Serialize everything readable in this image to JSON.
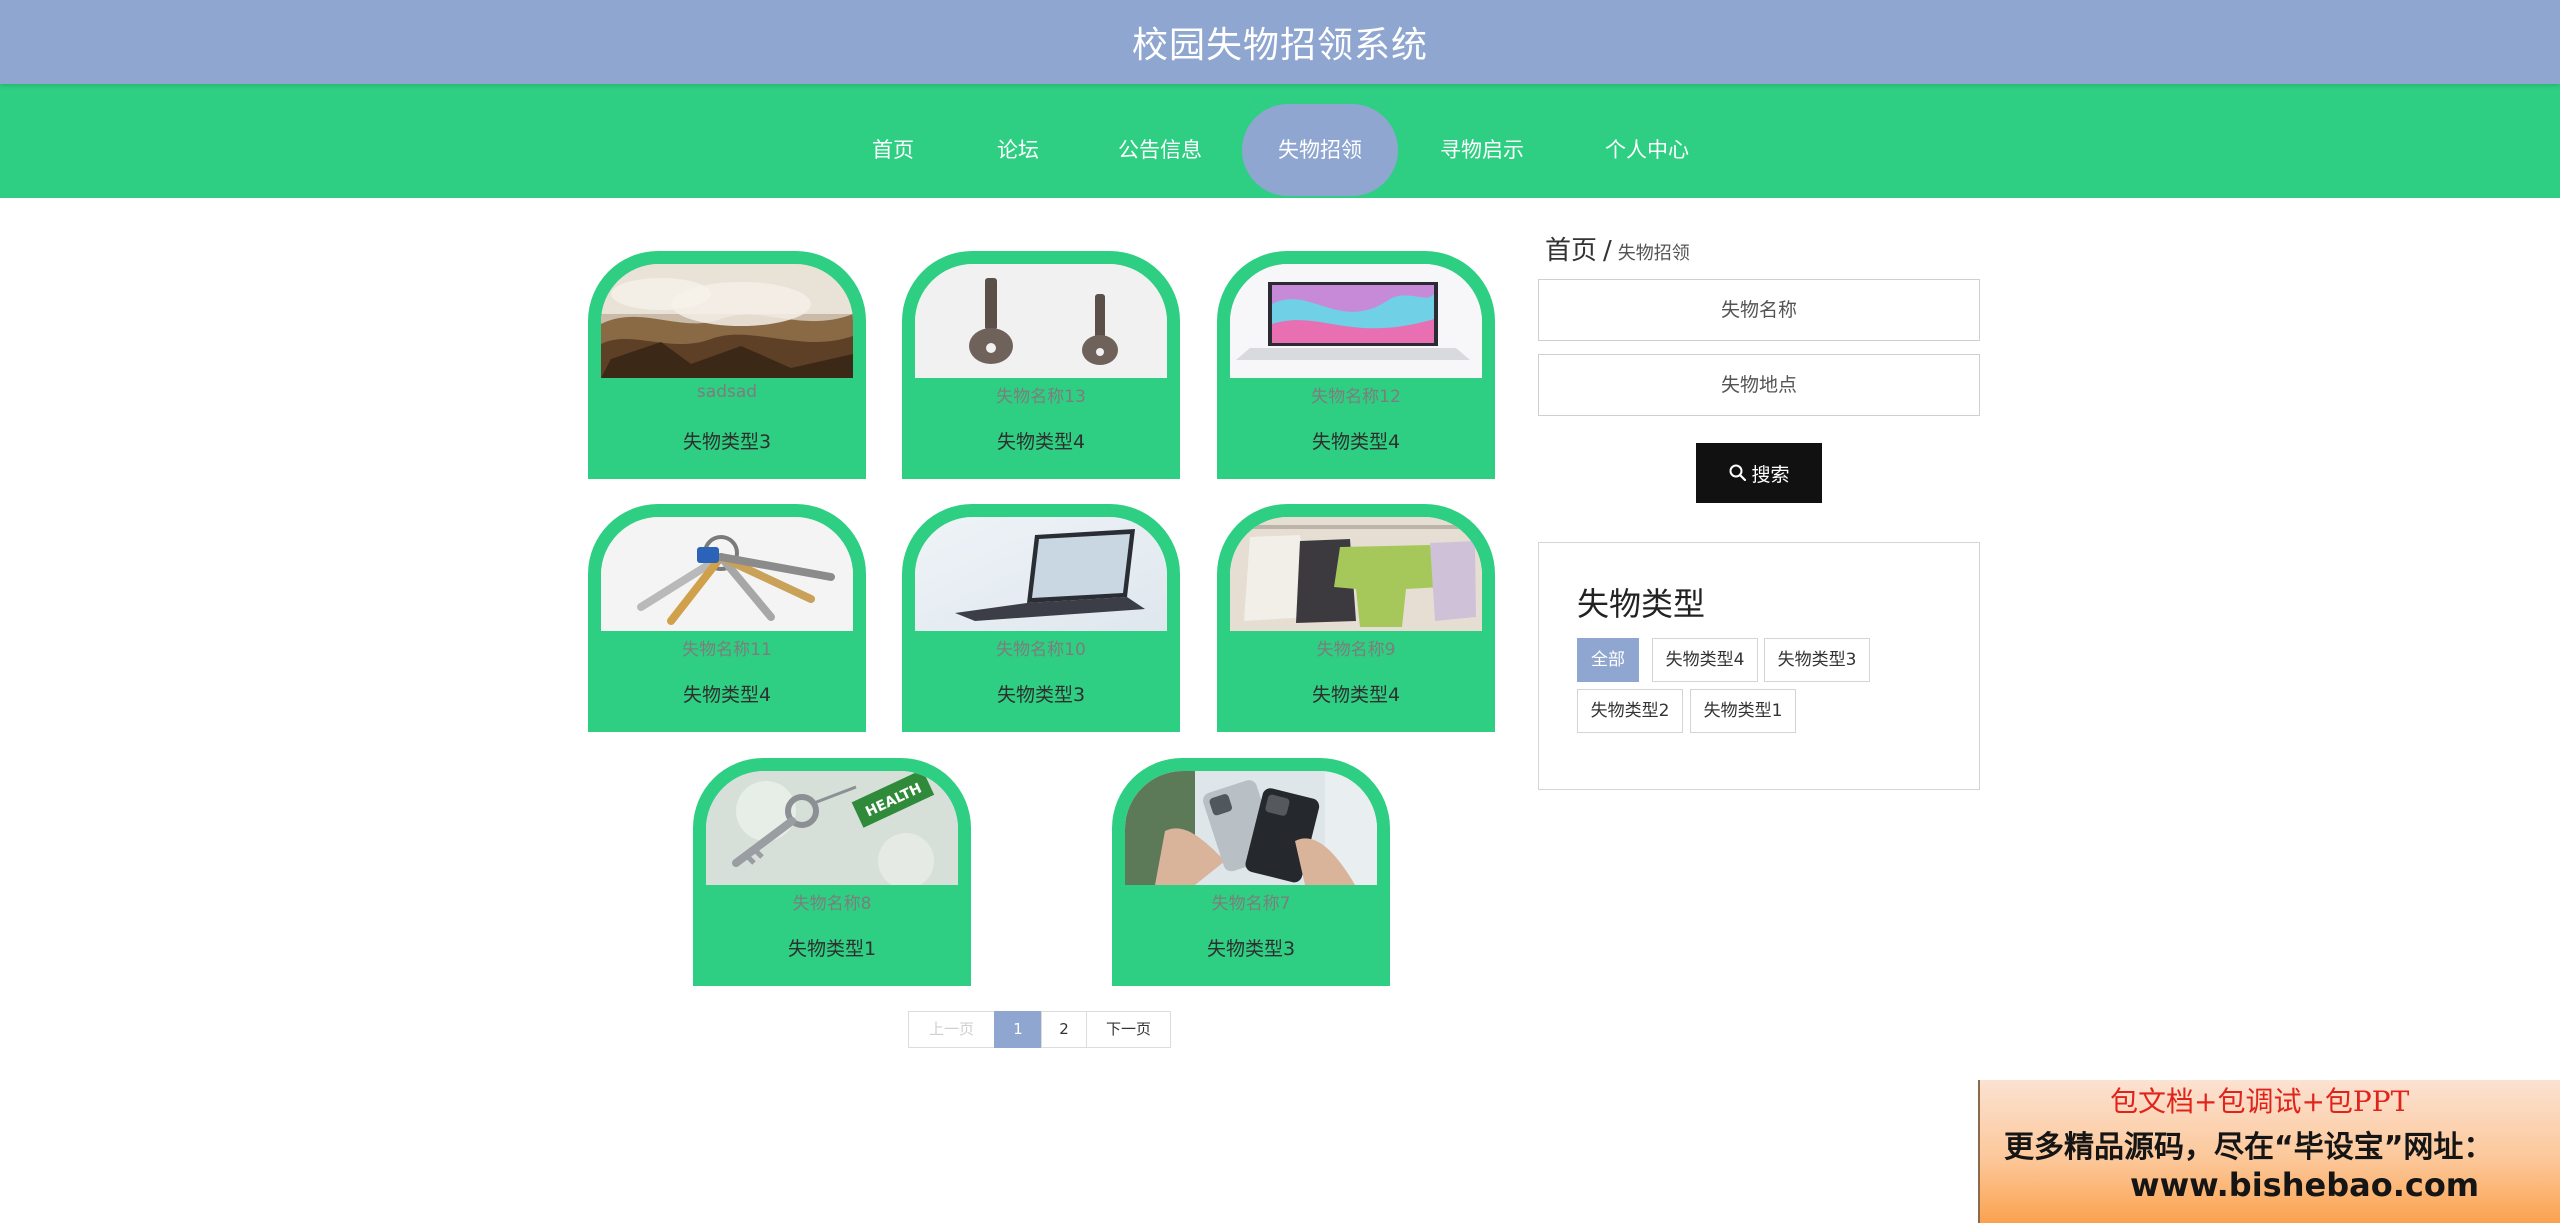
{
  "header": {
    "title": "校园失物招领系统"
  },
  "nav": {
    "items": [
      {
        "label": "首页"
      },
      {
        "label": "论坛"
      },
      {
        "label": "公告信息"
      },
      {
        "label": "失物招领",
        "active": true
      },
      {
        "label": "寻物启示"
      },
      {
        "label": "个人中心"
      }
    ]
  },
  "items": [
    {
      "name": "sadsad",
      "type": "失物类型3",
      "image": "rocky-waterfall"
    },
    {
      "name": "失物名称13",
      "type": "失物类型4",
      "image": "two-keys"
    },
    {
      "name": "失物名称12",
      "type": "失物类型4",
      "image": "laptop-colorful-screen"
    },
    {
      "name": "失物名称11",
      "type": "失物类型4",
      "image": "key-bunch"
    },
    {
      "name": "失物名称10",
      "type": "失物类型3",
      "image": "laptop-dark"
    },
    {
      "name": "失物名称9",
      "type": "失物类型4",
      "image": "clothes-on-rack"
    },
    {
      "name": "失物名称8",
      "type": "失物类型1",
      "image": "key-with-health-tag"
    },
    {
      "name": "失物名称7",
      "type": "失物类型3",
      "image": "two-phones-in-hands"
    }
  ],
  "item_images": {
    "key-tag_text": "HEALTH"
  },
  "pagination": {
    "prev": "上一页",
    "pages": [
      "1",
      "2"
    ],
    "current": "1",
    "next": "下一页"
  },
  "sidebar": {
    "breadcrumb": {
      "home": "首页",
      "separator": "/",
      "current": "失物招领"
    },
    "search": {
      "name_placeholder": "失物名称",
      "location_placeholder": "失物地点",
      "button_label": "搜索"
    },
    "categories": {
      "title": "失物类型",
      "tags": [
        {
          "label": "全部",
          "active": true
        },
        {
          "label": "失物类型4"
        },
        {
          "label": "失物类型3"
        },
        {
          "label": "失物类型2"
        },
        {
          "label": "失物类型1"
        }
      ]
    }
  },
  "promo": {
    "line1": "包文档+包调试+包PPT",
    "line2": "更多精品源码，尽在“毕设宝”网址：",
    "line3": "www.bishebao.com"
  },
  "colors": {
    "header_bg": "#8fa6d0",
    "nav_bg": "#2ecf82",
    "card_bg": "#2ecf82",
    "accent": "#8fa6d0",
    "button_bg": "#111111",
    "promo_red": "#e0241c"
  }
}
